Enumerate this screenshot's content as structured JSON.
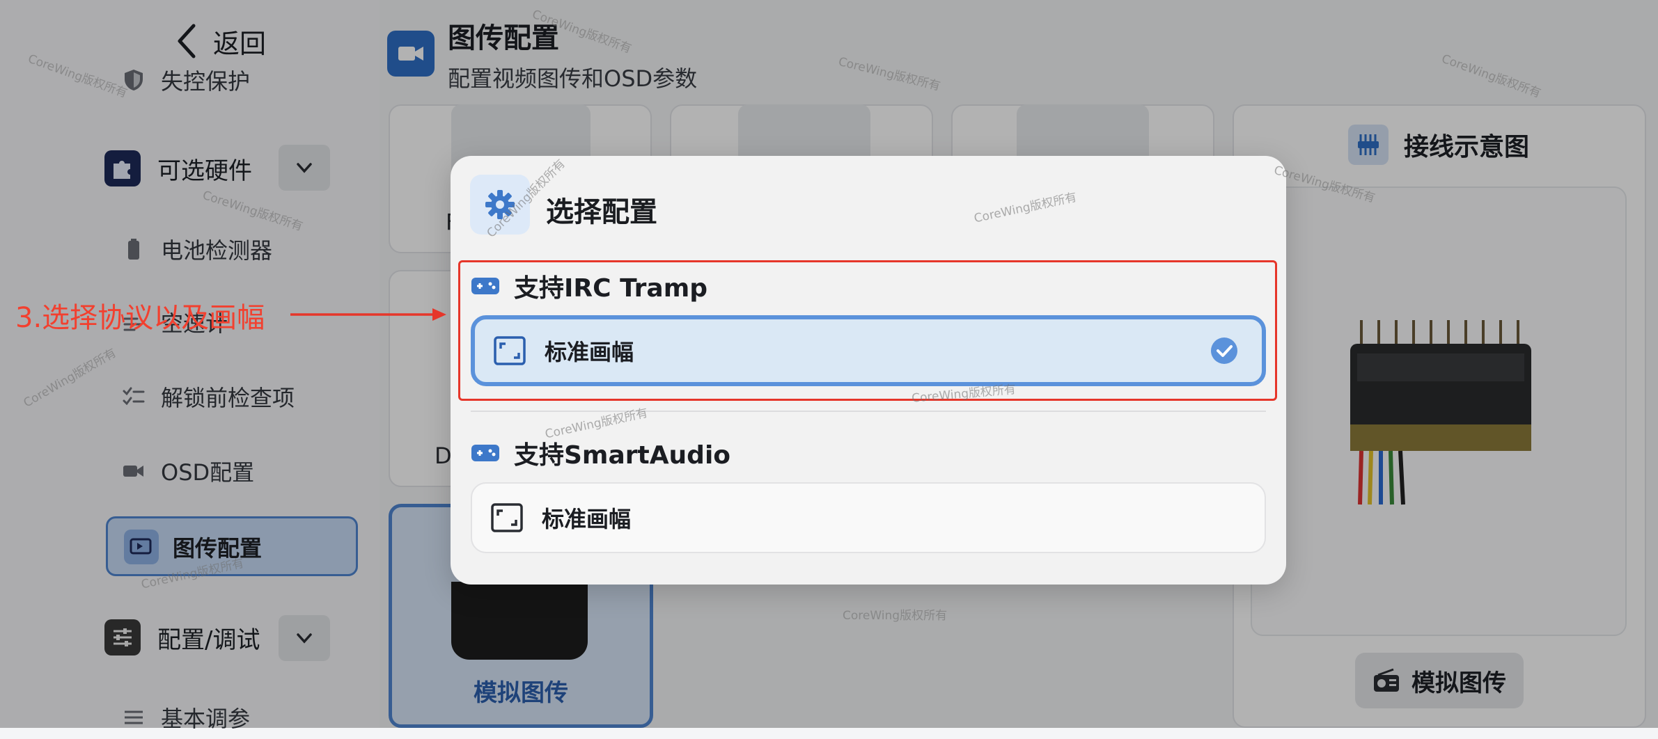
{
  "sidebar": {
    "back_label": "返回",
    "items": {
      "failsafe": "失控保护",
      "optional_hw": "可选硬件",
      "battery": "电池检测器",
      "airspeed": "空速计",
      "prearm": "解锁前检查项",
      "osd": "OSD配置",
      "vtx": "图传配置",
      "config_tune": "配置/调试",
      "basic_tune": "基本调参"
    }
  },
  "header": {
    "title": "图传配置",
    "subtitle": "配置视频图传和OSD参数"
  },
  "background": {
    "card_letter_1": "F",
    "card_letter_2": "D",
    "selected_card_label": "模拟图传",
    "wiring_title": "接线示意图",
    "wiring_button": "模拟图传"
  },
  "modal": {
    "title": "选择配置",
    "sections": [
      {
        "heading": "支持IRC Tramp",
        "option": "标准画幅",
        "selected": true
      },
      {
        "heading": "支持SmartAudio",
        "option": "标准画幅",
        "selected": false
      }
    ]
  },
  "annotation": {
    "text": "3.选择协议以及画幅"
  },
  "watermark": "CoreWing版权所有",
  "colors": {
    "accent": "#4f86d1",
    "annotation_red": "#e6362a",
    "selected_bg": "#dae8f5"
  }
}
